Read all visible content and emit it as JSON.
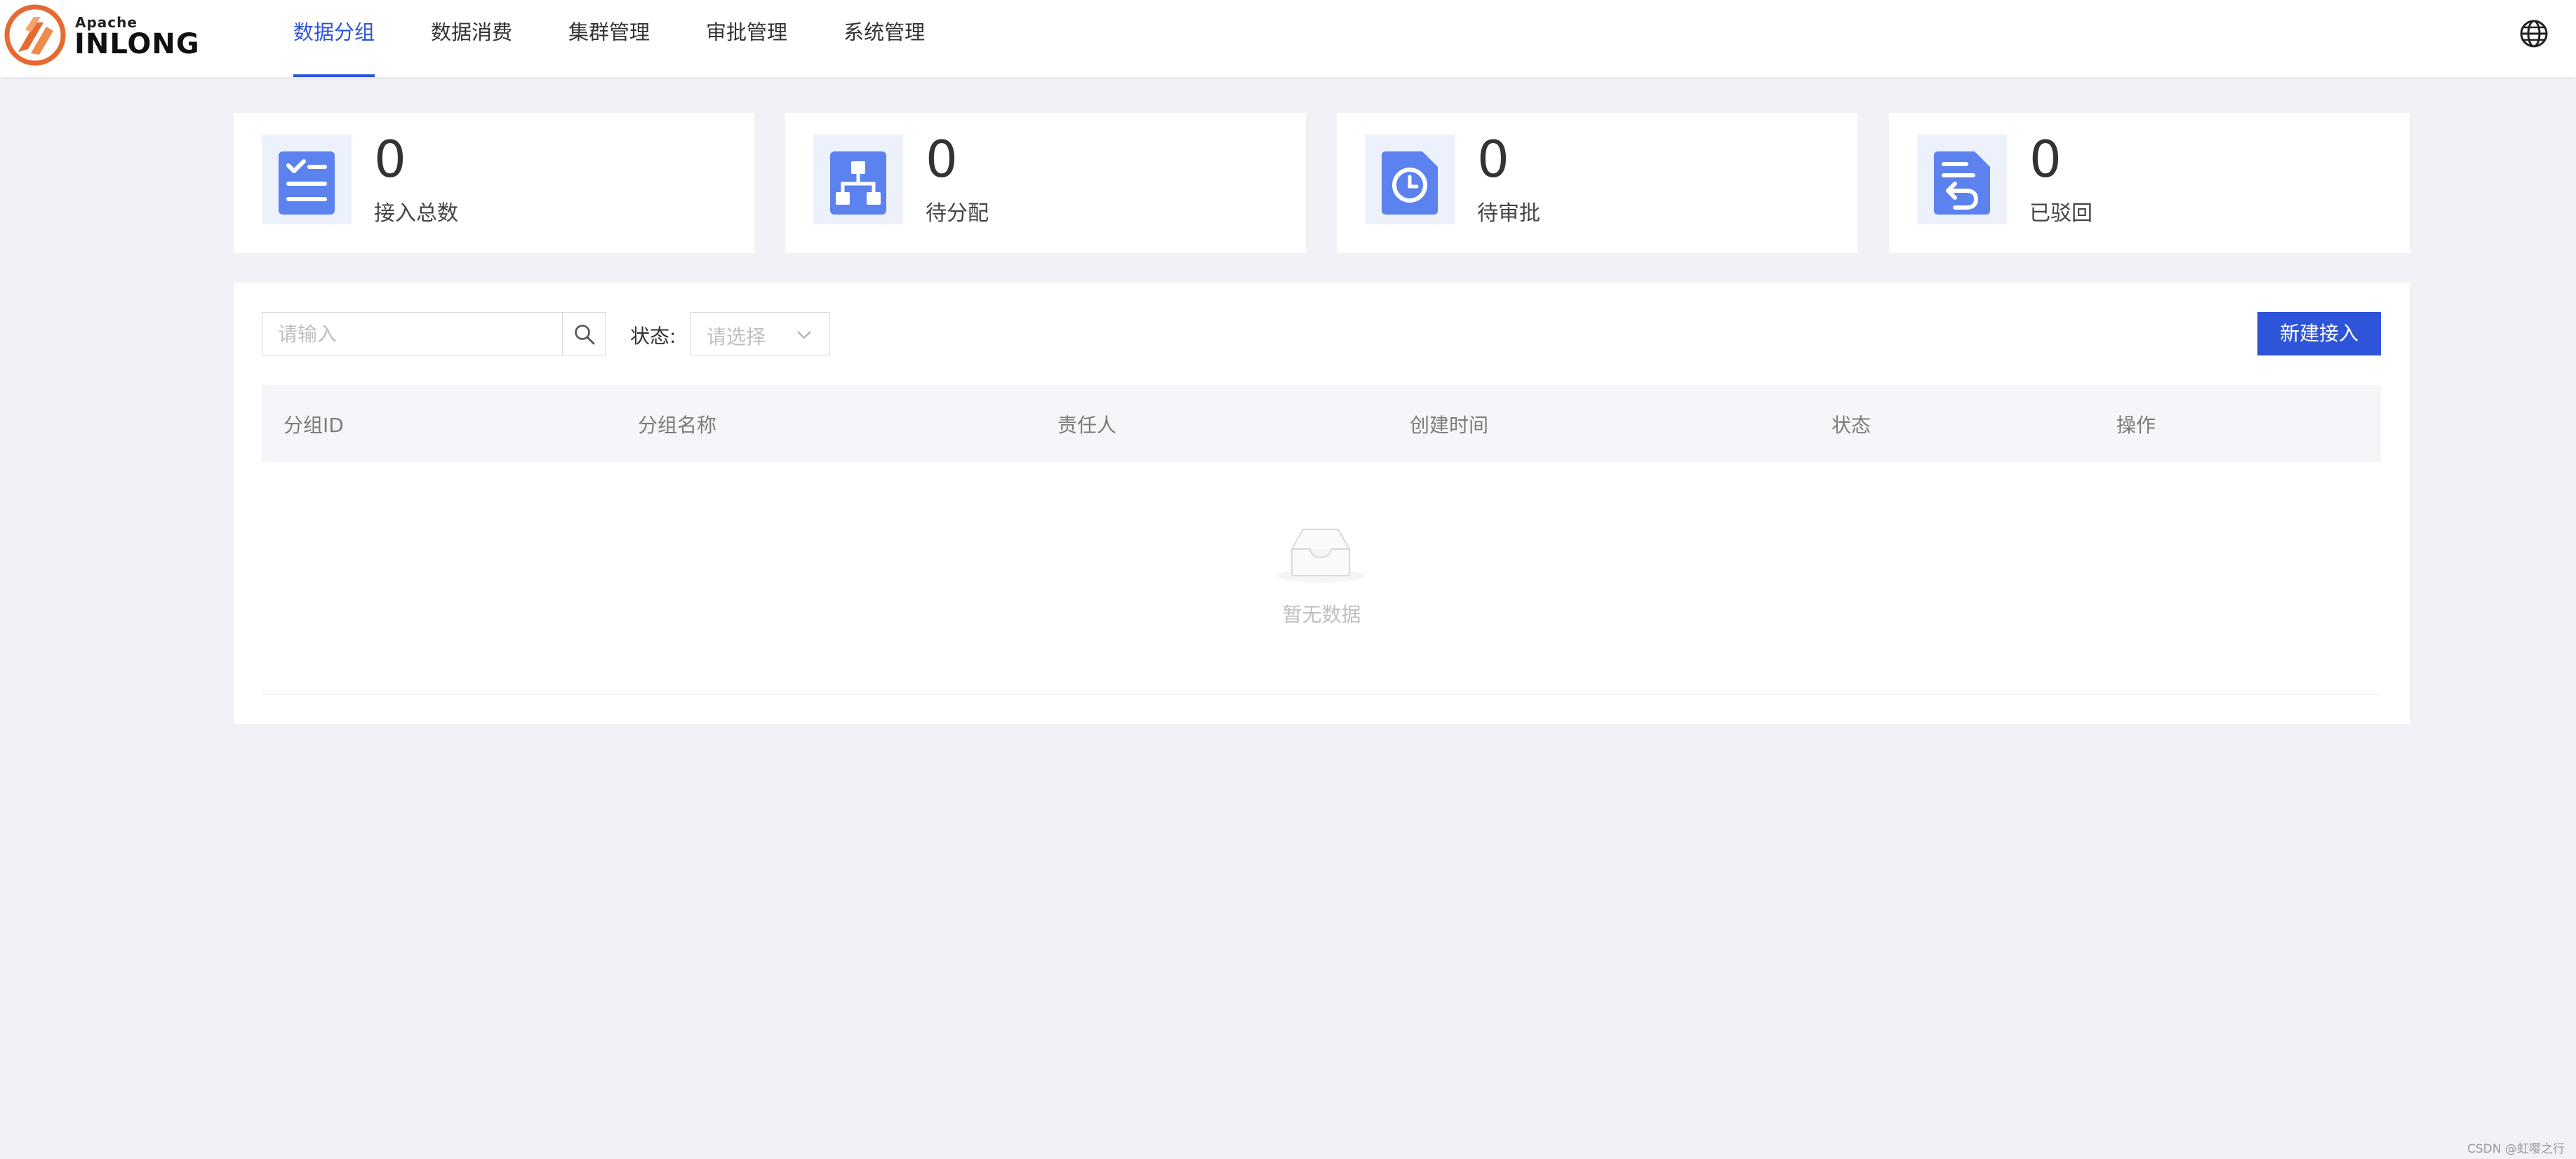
{
  "brand": {
    "sub": "Apache",
    "name": "INLONG",
    "colors": {
      "orange": "#e8692f",
      "accent": "#2e54d9"
    }
  },
  "nav": {
    "items": [
      {
        "label": "数据分组",
        "active": true
      },
      {
        "label": "数据消费"
      },
      {
        "label": "集群管理"
      },
      {
        "label": "审批管理"
      },
      {
        "label": "系统管理"
      }
    ],
    "language_icon": "globe-icon"
  },
  "stats": [
    {
      "value": "0",
      "label": "接入总数",
      "icon": "checklist-document-icon"
    },
    {
      "value": "0",
      "label": "待分配",
      "icon": "hierarchy-icon"
    },
    {
      "value": "0",
      "label": "待审批",
      "icon": "clock-document-icon"
    },
    {
      "value": "0",
      "label": "已驳回",
      "icon": "return-document-icon"
    }
  ],
  "toolbar": {
    "search_placeholder": "请输入",
    "status_label": "状态:",
    "status_placeholder": "请选择",
    "new_button": "新建接入"
  },
  "table": {
    "columns": [
      "分组ID",
      "分组名称",
      "责任人",
      "创建时间",
      "状态",
      "操作"
    ],
    "rows": [],
    "empty_text": "暂无数据"
  },
  "watermark": "CSDN @虹嘤之行"
}
